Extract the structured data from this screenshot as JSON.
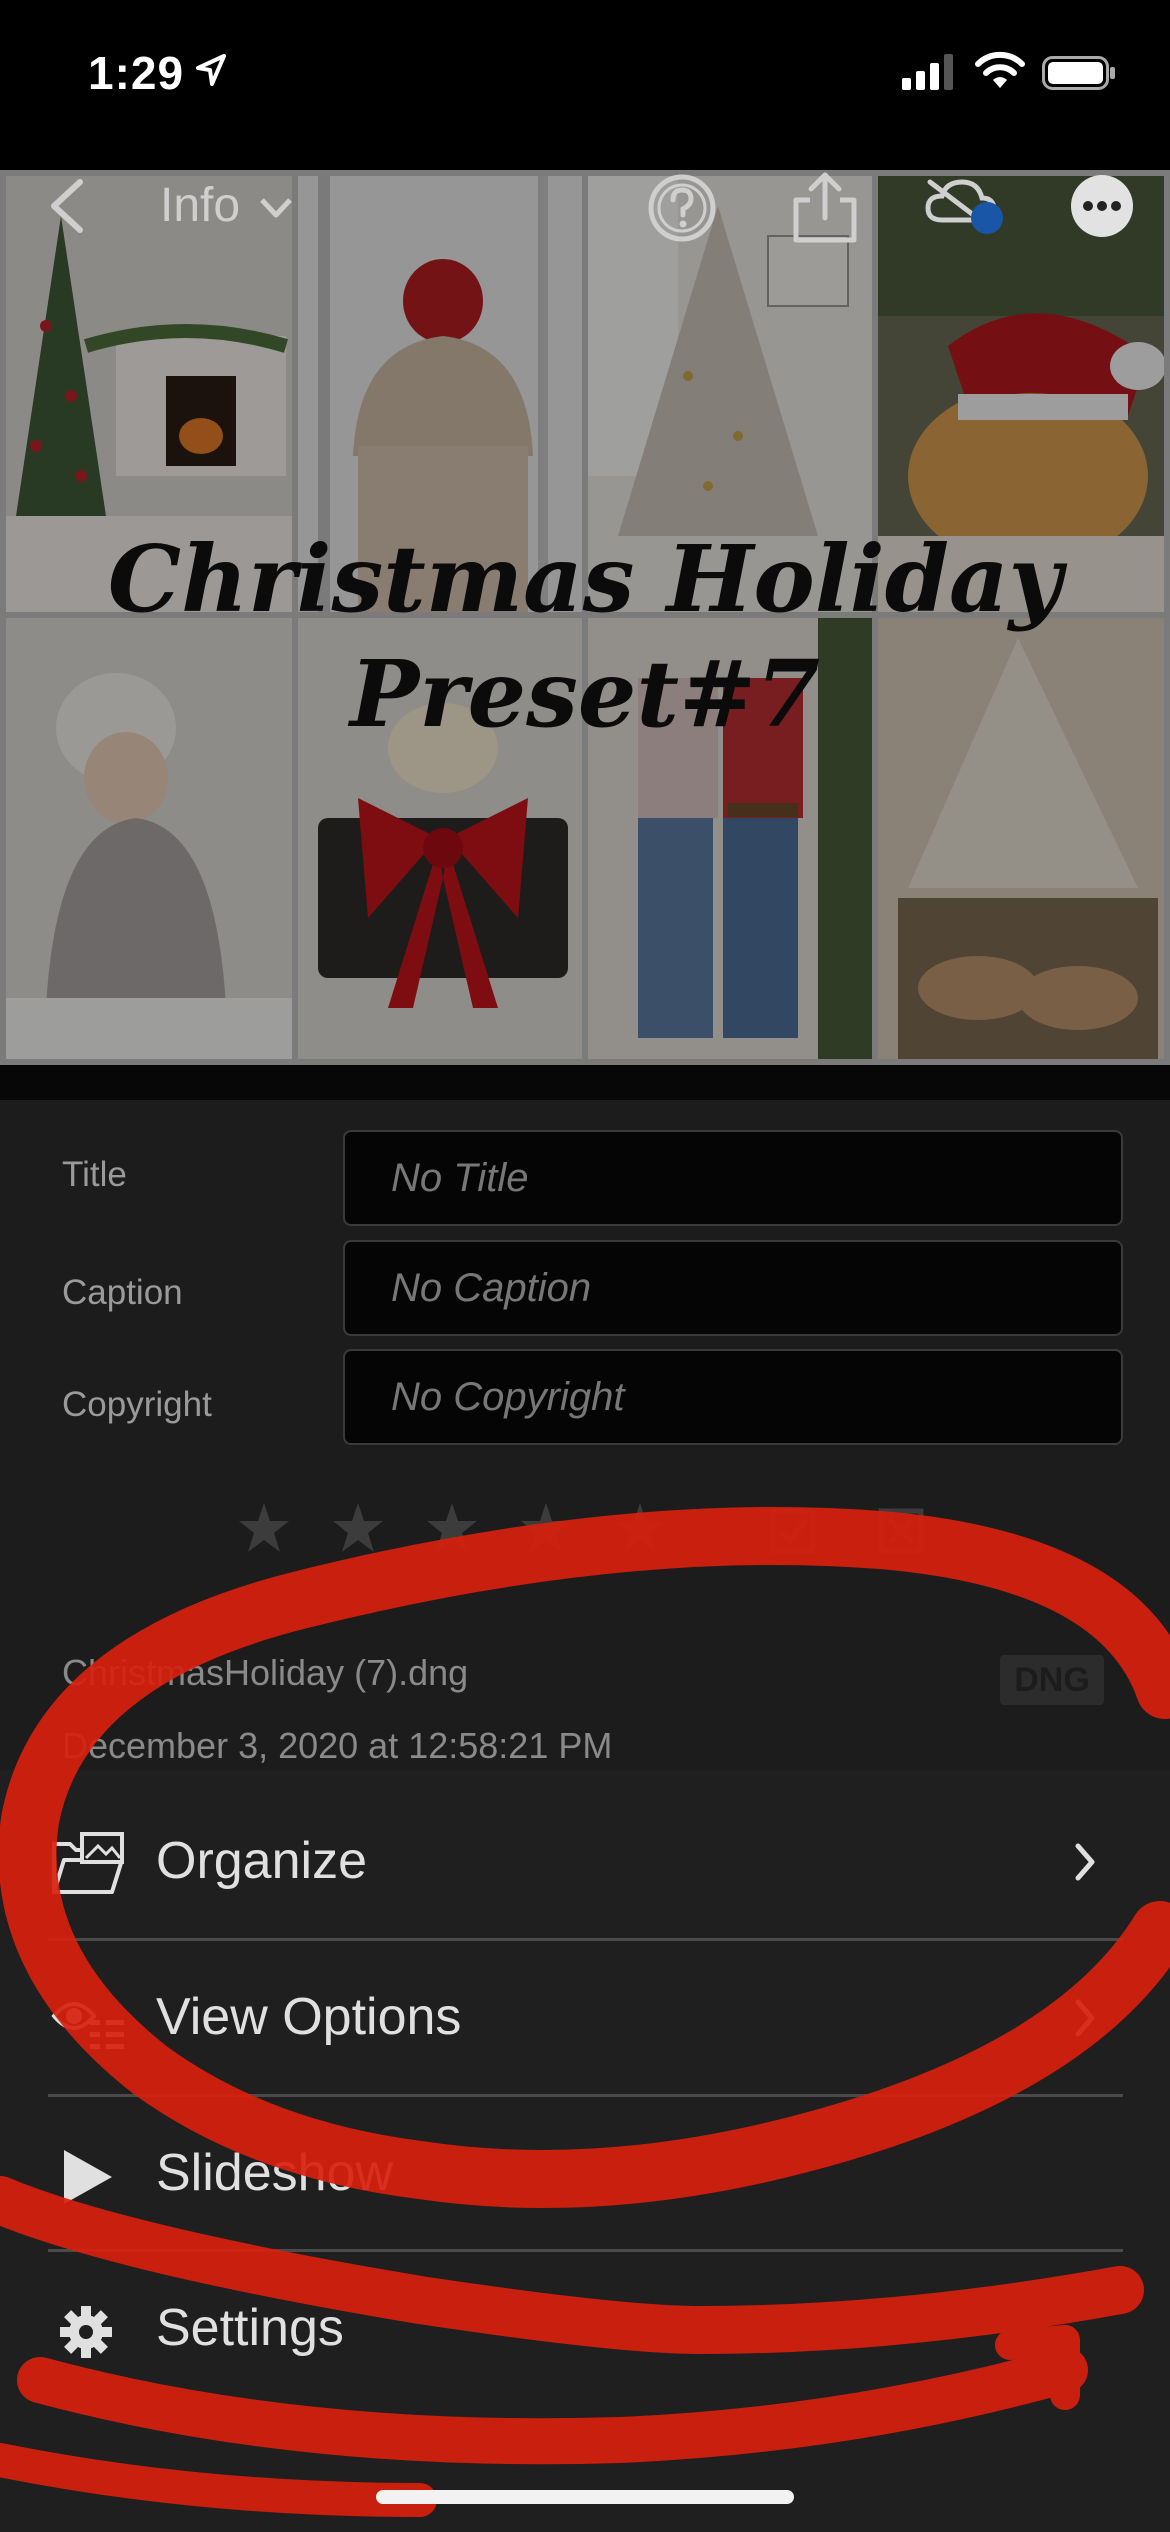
{
  "status_bar": {
    "time": "1:29"
  },
  "toolbar": {
    "back_icon": "chevron-left-icon",
    "info_label": "Info",
    "help_icon": "help-icon",
    "share_icon": "share-icon",
    "cloud_icon": "cloud-sync-icon",
    "more_icon": "more-icon"
  },
  "photo": {
    "title_line1": "Christmas Holiday",
    "title_line2": "Preset#7"
  },
  "info": {
    "fields": [
      {
        "label": "Title",
        "placeholder": "No Title"
      },
      {
        "label": "Caption",
        "placeholder": "No Caption"
      },
      {
        "label": "Copyright",
        "placeholder": "No Copyright"
      }
    ],
    "rating": 0,
    "max_rating": 5,
    "filename": "ChristmasHoliday (7).dng",
    "date": "December 3, 2020 at 12:58:21 PM",
    "format_badge": "DNG"
  },
  "menu": {
    "items": [
      {
        "label": "Organize",
        "icon": "folder-photos-icon",
        "has_chevron": true
      },
      {
        "label": "View Options",
        "icon": "eye-list-icon",
        "has_chevron": true
      },
      {
        "label": "Slideshow",
        "icon": "play-icon",
        "has_chevron": false
      },
      {
        "label": "Settings",
        "icon": "gear-icon",
        "has_chevron": false
      }
    ]
  },
  "colors": {
    "annotation": "#d8200e",
    "sheet": "#1f1f1f",
    "panel": "#1c1c1c",
    "cloud_dot": "#1a56a8"
  }
}
